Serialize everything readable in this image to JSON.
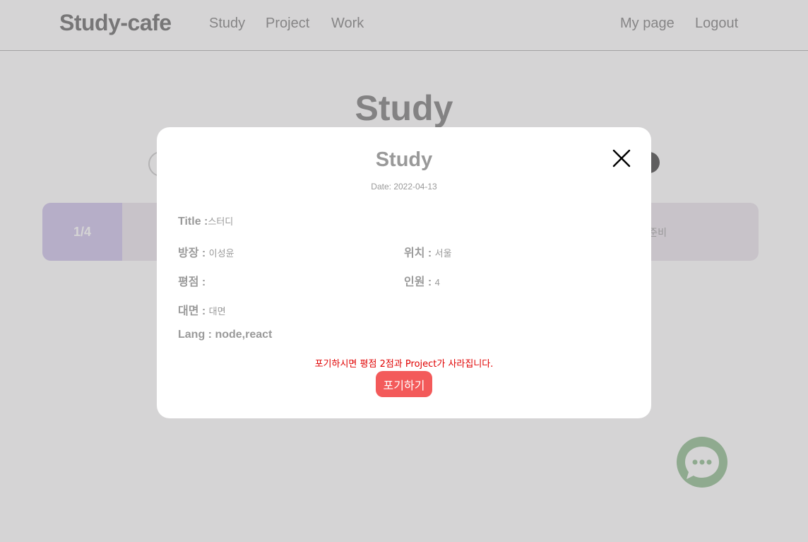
{
  "navbar": {
    "brand": "Study-cafe",
    "links": [
      "Study",
      "Project",
      "Work"
    ],
    "right_links": [
      "My page",
      "Logout"
    ]
  },
  "main": {
    "title": "Study",
    "card": {
      "index": "1/4",
      "status": "준비"
    }
  },
  "modal": {
    "title": "Study",
    "date": "Date: 2022-04-13",
    "fields": {
      "title_label": "Title :",
      "title_value": "스터디",
      "leader_label": "방장 :",
      "leader_value": "이성윤",
      "location_label": "위치 :",
      "location_value": "서울",
      "rating_label": "평점 :",
      "rating_value": "",
      "members_label": "인원 :",
      "members_value": "4",
      "meeting_label": "대면 :",
      "meeting_value": "대면",
      "lang_label": "Lang :",
      "lang_value": "node,react"
    },
    "warning": "포기하시면 평점 2점과 Project가 사라집니다.",
    "giveup_label": "포기하기"
  },
  "colors": {
    "warning": "#e00000",
    "giveup_button": "#f35a5a",
    "card_index": "#d2c8ec",
    "chat_fab": "#9ac29a"
  },
  "icons": {
    "close": "close-icon",
    "chat": "chat-bubble-icon"
  }
}
